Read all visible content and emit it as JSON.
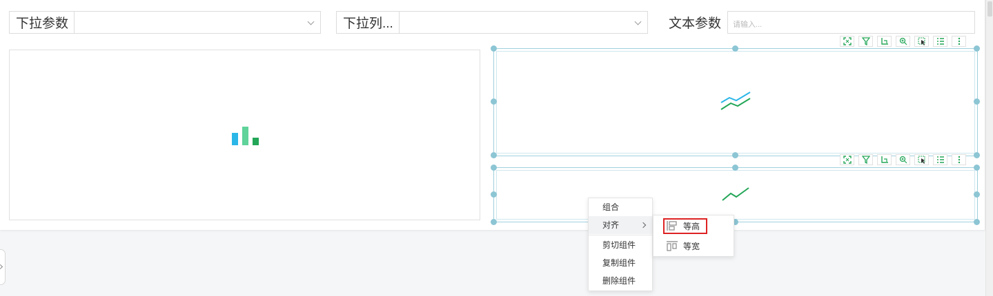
{
  "params": [
    {
      "label": "下拉参数",
      "value": ""
    },
    {
      "label": "下拉列...",
      "value": ""
    },
    {
      "label": "文本参数",
      "placeholder": "请输入..."
    }
  ],
  "widget_toolbar": {
    "icons": [
      "fullscreen-icon",
      "filter-icon",
      "axis-icon",
      "zoom-icon",
      "select-icon",
      "list-icon",
      "more-icon"
    ]
  },
  "chart_placeholders": {
    "left": {
      "icon": "bar-chart-icon",
      "colors": [
        "#2bb6e8",
        "#5fd39a",
        "#23a657"
      ]
    },
    "right_top": {
      "icon": "line-chart-icon",
      "colors": [
        "#2bb6e8",
        "#23a657"
      ]
    },
    "right_bottom": {
      "icon": "line-chart-icon",
      "colors": [
        "#23a657"
      ]
    }
  },
  "context_menu": {
    "items": [
      "组合",
      "对齐",
      "剪切组件",
      "复制组件",
      "删除组件"
    ],
    "highlighted": "对齐"
  },
  "align_submenu": {
    "items": [
      "等高",
      "等宽"
    ],
    "highlighted": "等高"
  },
  "colors": {
    "selection": "#8cc5d4",
    "accent_green": "#23a657",
    "highlight_border": "#dd2222"
  }
}
